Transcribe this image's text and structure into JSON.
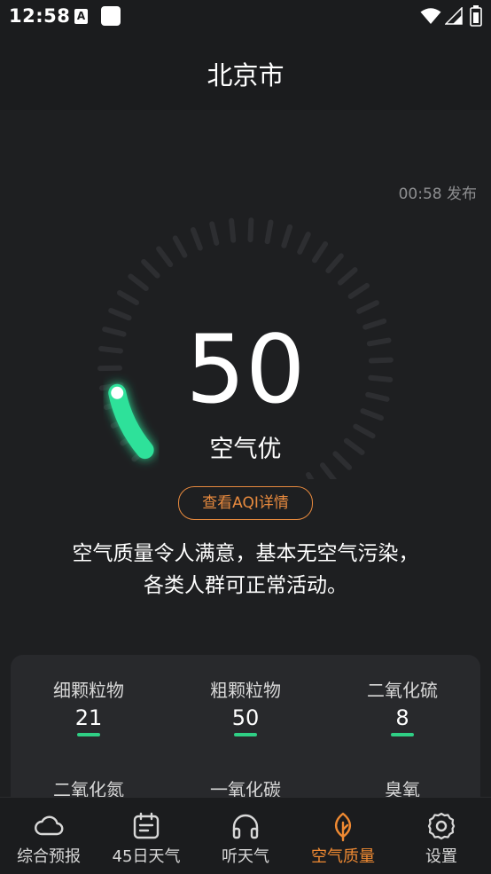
{
  "status_bar": {
    "time": "12:58",
    "notification_letter": "A"
  },
  "header": {
    "city": "北京市"
  },
  "publish_time": "00:58 发布",
  "aqi": {
    "value": "50",
    "level": "空气优",
    "gauge_fraction": 0.1,
    "accent_color": "#2fe19a"
  },
  "detail_button": {
    "label": "查看AQI详情",
    "color": "#e88a3e"
  },
  "description": {
    "line1": "空气质量令人满意，基本无空气污染，",
    "line2": "各类人群可正常活动。"
  },
  "pollutants": [
    {
      "name": "细颗粒物",
      "value": "21"
    },
    {
      "name": "粗颗粒物",
      "value": "50"
    },
    {
      "name": "二氧化硫",
      "value": "8"
    },
    {
      "name": "二氧化氮",
      "value": ""
    },
    {
      "name": "一氧化碳",
      "value": ""
    },
    {
      "name": "臭氧",
      "value": ""
    }
  ],
  "bottom_nav": {
    "items": [
      {
        "label": "综合预报",
        "icon": "cloud-icon"
      },
      {
        "label": "45日天气",
        "icon": "calendar-icon"
      },
      {
        "label": "听天气",
        "icon": "headphones-icon"
      },
      {
        "label": "空气质量",
        "icon": "leaf-icon",
        "active": true
      },
      {
        "label": "设置",
        "icon": "gear-icon"
      }
    ],
    "active_color": "#f08a32"
  }
}
